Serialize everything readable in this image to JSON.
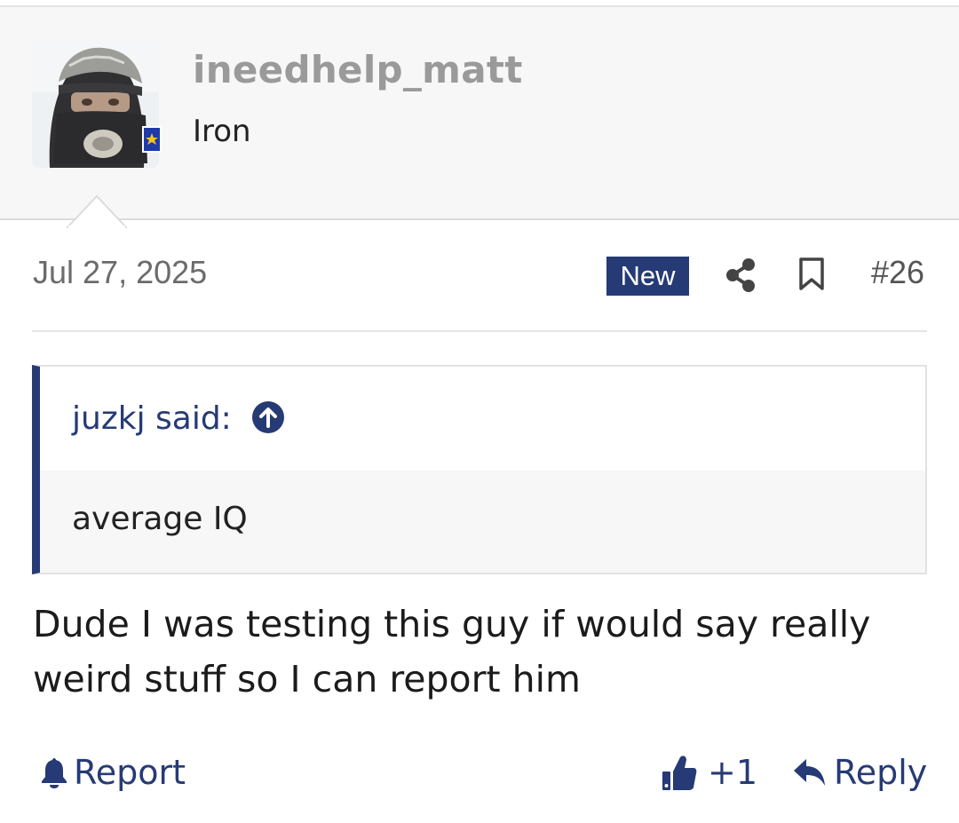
{
  "user": {
    "name": "ineedhelp_matt",
    "title": "Iron",
    "avatar_icon": "user-avatar-photo",
    "rank_icon": "rank-badge-icon"
  },
  "meta": {
    "date": "Jul 27, 2025",
    "new_badge": "New",
    "post_number": "#26",
    "share_icon": "share-icon",
    "bookmark_icon": "bookmark-icon"
  },
  "quote": {
    "attribution": "juzkj said:",
    "jump_icon": "arrow-up-circle-icon",
    "text": "average IQ"
  },
  "message": {
    "text": "Dude I was testing this guy if would say really weird stuff so I can report him"
  },
  "actions": {
    "report_label": "Report",
    "report_icon": "bell-icon",
    "reaction_count": "+1",
    "reaction_icon": "thumbs-up-icon",
    "reply_label": "Reply",
    "reply_icon": "reply-arrow-icon"
  },
  "colors": {
    "accent": "#263a75",
    "header_bg": "#f7f7f7",
    "username": "#9a9a9a",
    "text": "#1b1b1b",
    "muted": "#6b6b6b"
  }
}
